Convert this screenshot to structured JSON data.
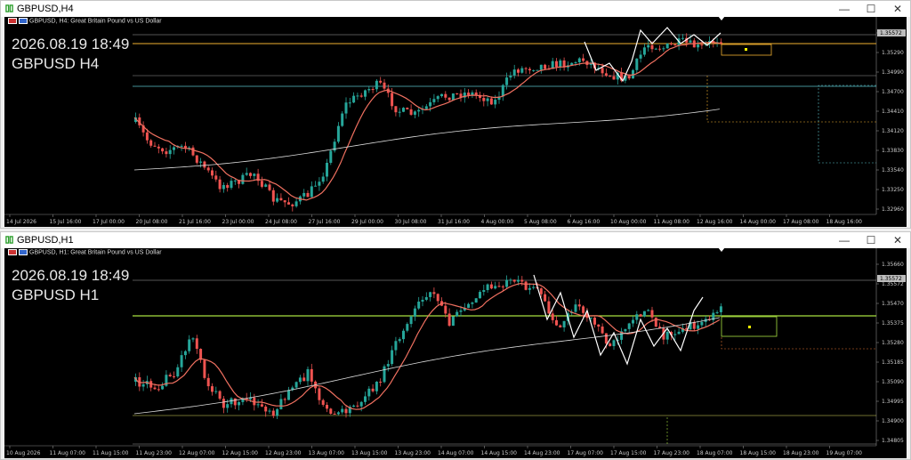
{
  "windows": [
    {
      "title": "GBPUSD,H4",
      "header": "GBPUSD, H4:  Great Britain Pound vs US Dollar",
      "datetime": "2026.08.19 18:49",
      "symbol_tf": "GBPUSD H4",
      "price_tag": "1.35572",
      "price_labels": [
        "1.35572",
        "1.35290",
        "1.34990",
        "1.34700",
        "1.34410",
        "1.34120",
        "1.33830",
        "1.33540",
        "1.33250",
        "1.32960"
      ],
      "time_labels": [
        "14 Jul 2026",
        "15 Jul 16:00",
        "17 Jul 00:00",
        "20 Jul 08:00",
        "21 Jul 16:00",
        "23 Jul 00:00",
        "24 Jul 08:00",
        "27 Jul 16:00",
        "29 Jul 00:00",
        "30 Jul 08:00",
        "31 Jul 16:00",
        "4 Aug 00:00",
        "5 Aug 08:00",
        "6 Aug 16:00",
        "10 Aug 00:00",
        "11 Aug 08:00",
        "12 Aug 16:00",
        "14 Aug 00:00",
        "17 Aug 08:00",
        "18 Aug 16:00"
      ],
      "colors": {
        "bull": "#26a69a",
        "bear": "#ef5350",
        "ma_fast": "#f07060",
        "ma_slow": "#dddddd",
        "level": "#f0b030",
        "line2": "#5bc0c8"
      }
    },
    {
      "title": "GBPUSD,H1",
      "header": "GBPUSD, H1:  Great Britain Pound vs US Dollar",
      "datetime": "2026.08.19 18:49",
      "symbol_tf": "GBPUSD H1",
      "price_tag": "1.35572",
      "price_labels": [
        "1.35660",
        "1.35572",
        "1.35470",
        "1.35375",
        "1.35280",
        "1.35185",
        "1.35090",
        "1.34995",
        "1.34900",
        "1.34805"
      ],
      "time_labels": [
        "10 Aug 2026",
        "11 Aug 07:00",
        "11 Aug 15:00",
        "11 Aug 23:00",
        "12 Aug 07:00",
        "12 Aug 15:00",
        "12 Aug 23:00",
        "13 Aug 07:00",
        "13 Aug 15:00",
        "13 Aug 23:00",
        "14 Aug 07:00",
        "14 Aug 15:00",
        "14 Aug 23:00",
        "17 Aug 07:00",
        "17 Aug 15:00",
        "17 Aug 23:00",
        "18 Aug 07:00",
        "18 Aug 15:00",
        "18 Aug 23:00",
        "19 Aug 07:00"
      ],
      "colors": {
        "bull": "#26a69a",
        "bear": "#ef5350",
        "ma_fast": "#f07060",
        "ma_slow": "#dddddd",
        "level": "#a8e040",
        "line2": "#e0e060"
      }
    }
  ],
  "controls": {
    "minimize": "—",
    "maximize": "☐",
    "close": "✕"
  }
}
